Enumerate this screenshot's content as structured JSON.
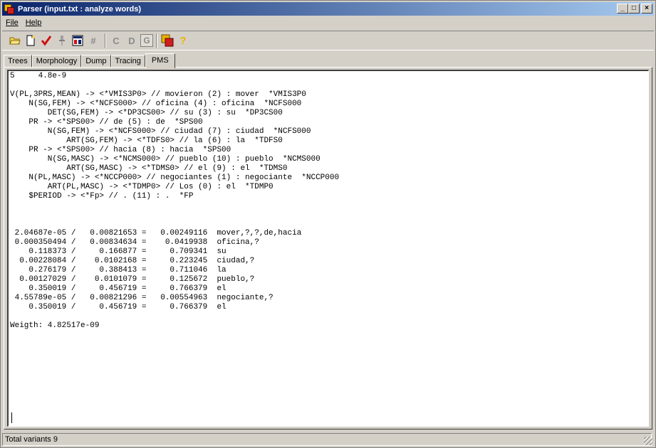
{
  "window": {
    "title": "Parser (input.txt : analyze words)",
    "controls": {
      "minimize": "_",
      "maximize": "□",
      "close": "×"
    }
  },
  "menu": {
    "file": "File",
    "help": "Help"
  },
  "toolbar": {
    "icons": [
      "open-folder-icon",
      "new-document-icon",
      "check-icon",
      "pin-icon",
      "grid-icon",
      "hash-icon",
      "c-icon",
      "d-icon",
      "g-icon",
      "parser-app-icon",
      "help-icon"
    ],
    "letters": {
      "hash": "#",
      "c": "C",
      "d": "D",
      "g": "G",
      "help": "?"
    }
  },
  "tabs": [
    {
      "label": "Trees",
      "active": false
    },
    {
      "label": "Morphology",
      "active": false
    },
    {
      "label": "Dump",
      "active": false
    },
    {
      "label": "Tracing",
      "active": false
    },
    {
      "label": "PMS",
      "active": true
    }
  ],
  "output": {
    "lines": [
      "5     4.8e-9",
      "",
      "V(PL,3PRS,MEAN) -> <*VMIS3P0> // movieron (2) : mover  *VMIS3P0",
      "    N(SG,FEM) -> <*NCFS000> // oficina (4) : oficina  *NCFS000",
      "        DET(SG,FEM) -> <*DP3CS00> // su (3) : su  *DP3CS00",
      "    PR -> <*SPS00> // de (5) : de  *SPS00",
      "        N(SG,FEM) -> <*NCFS000> // ciudad (7) : ciudad  *NCFS000",
      "            ART(SG,FEM) -> <*TDFS0> // la (6) : la  *TDFS0",
      "    PR -> <*SPS00> // hacia (8) : hacia  *SPS00",
      "        N(SG,MASC) -> <*NCMS000> // pueblo (10) : pueblo  *NCMS000",
      "            ART(SG,MASC) -> <*TDMS0> // el (9) : el  *TDMS0",
      "    N(PL,MASC) -> <*NCCP000> // negociantes (1) : negociante  *NCCP000",
      "        ART(PL,MASC) -> <*TDMP0> // Los (0) : el  *TDMP0",
      "    $PERIOD -> <*Fp> // . (11) : .  *FP",
      "",
      "",
      "",
      " 2.04687e-05 /   0.00821653 =   0.00249116  mover,?,?,de,hacia",
      " 0.000350494 /   0.00834634 =    0.0419938  oficina,?",
      "    0.118373 /     0.166877 =     0.709341  su",
      "  0.00228084 /    0.0102168 =     0.223245  ciudad,?",
      "    0.276179 /     0.388413 =     0.711046  la",
      "  0.00127029 /    0.0101079 =     0.125672  pueblo,?",
      "    0.350019 /     0.456719 =     0.766379  el",
      " 4.55789e-05 /   0.00821296 =   0.00554963  negociante,?",
      "    0.350019 /     0.456719 =     0.766379  el",
      "",
      "Weigth: 4.82517e-09"
    ]
  },
  "status": {
    "text": "Total variants 9"
  }
}
